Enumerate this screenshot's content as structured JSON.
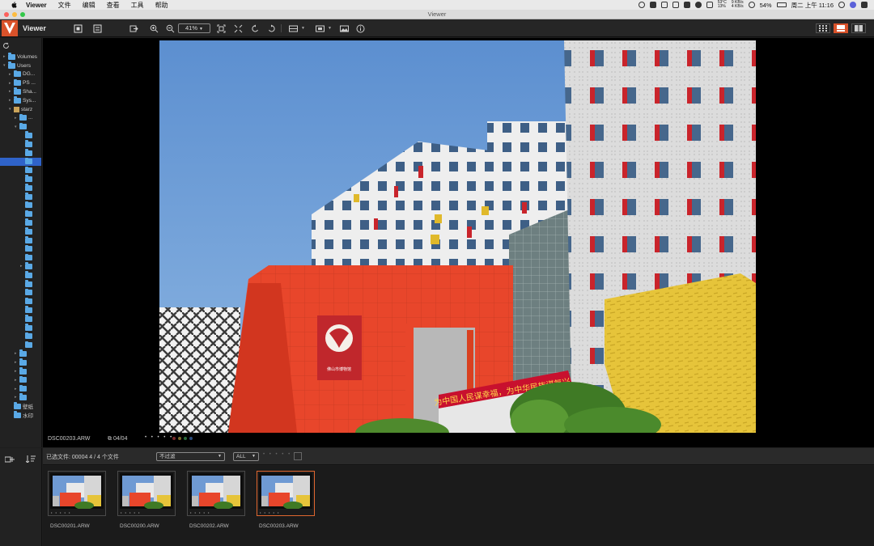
{
  "menubar": {
    "items": [
      "Viewer",
      "文件",
      "编辑",
      "查看",
      "工具",
      "帮助"
    ],
    "temp_top": "53°C",
    "temp_bottom": "13%",
    "net_top": "9 KB/s",
    "net_bottom": "4 KB/s",
    "battery": "54%",
    "clock": "周二 上午 11:16"
  },
  "window": {
    "title": "Viewer"
  },
  "toolbar": {
    "app_name": "Viewer",
    "zoom_level": "41%",
    "icons": [
      "fit-icon",
      "fullscreen-icon",
      "export-icon",
      "zoom-in-icon",
      "zoom-out-icon",
      "fit-screen-icon",
      "expand-icon",
      "rotate-left-icon",
      "rotate-right-icon",
      "compare-icon",
      "slideshow-icon",
      "image-icon",
      "info-icon",
      "grid-view-icon",
      "single-view-icon",
      "split-view-icon"
    ]
  },
  "sidebar": {
    "tree": [
      {
        "label": "Volumes",
        "indent": 0,
        "tri": "▸"
      },
      {
        "label": "Users",
        "indent": 0,
        "tri": "▾"
      },
      {
        "label": "DG...",
        "indent": 1,
        "tri": "▸"
      },
      {
        "label": "PS ...",
        "indent": 1,
        "tri": "▸"
      },
      {
        "label": "Sha...",
        "indent": 1,
        "tri": "▸"
      },
      {
        "label": "Sys...",
        "indent": 1,
        "tri": "▸"
      },
      {
        "label": "starz",
        "indent": 1,
        "tri": "▾",
        "home": true
      },
      {
        "label": "...",
        "indent": 2,
        "tri": "▸"
      },
      {
        "label": "",
        "indent": 2,
        "tri": "▾"
      },
      {
        "label": "",
        "indent": 3,
        "tri": ""
      },
      {
        "label": "",
        "indent": 3,
        "tri": ""
      },
      {
        "label": "",
        "indent": 3,
        "tri": ""
      },
      {
        "label": "",
        "indent": 3,
        "tri": "",
        "selected": true
      },
      {
        "label": "",
        "indent": 3,
        "tri": ""
      },
      {
        "label": "",
        "indent": 3,
        "tri": ""
      },
      {
        "label": "",
        "indent": 3,
        "tri": ""
      },
      {
        "label": "",
        "indent": 3,
        "tri": ""
      },
      {
        "label": "",
        "indent": 3,
        "tri": ""
      },
      {
        "label": "",
        "indent": 3,
        "tri": ""
      },
      {
        "label": "",
        "indent": 3,
        "tri": ""
      },
      {
        "label": "",
        "indent": 3,
        "tri": ""
      },
      {
        "label": "",
        "indent": 3,
        "tri": ""
      },
      {
        "label": "",
        "indent": 3,
        "tri": ""
      },
      {
        "label": "",
        "indent": 3,
        "tri": ""
      },
      {
        "label": "",
        "indent": 3,
        "tri": "▸"
      },
      {
        "label": "",
        "indent": 3,
        "tri": ""
      },
      {
        "label": "",
        "indent": 3,
        "tri": ""
      },
      {
        "label": "",
        "indent": 3,
        "tri": ""
      },
      {
        "label": "",
        "indent": 3,
        "tri": ""
      },
      {
        "label": "",
        "indent": 3,
        "tri": ""
      },
      {
        "label": "",
        "indent": 3,
        "tri": ""
      },
      {
        "label": "",
        "indent": 3,
        "tri": ""
      },
      {
        "label": "",
        "indent": 3,
        "tri": ""
      },
      {
        "label": "",
        "indent": 3,
        "tri": ""
      },
      {
        "label": "",
        "indent": 2,
        "tri": "▸"
      },
      {
        "label": "",
        "indent": 2,
        "tri": "▸"
      },
      {
        "label": "",
        "indent": 2,
        "tri": "▸"
      },
      {
        "label": "",
        "indent": 2,
        "tri": "▸"
      },
      {
        "label": "",
        "indent": 2,
        "tri": "▸"
      },
      {
        "label": "",
        "indent": 2,
        "tri": "▸"
      },
      {
        "label": "壁纸",
        "indent": 1,
        "tri": ""
      },
      {
        "label": "水印",
        "indent": 1,
        "tri": ""
      }
    ]
  },
  "viewer": {
    "filename": "DSC00203.ARW",
    "counter": "04/04",
    "rating_stars": "• • • • •",
    "photo_description_icon": "photo-buildings",
    "sign_logo_text": "佛山市博物馆",
    "banner_text": "为中国人民谋幸福，为中华民族谋复兴"
  },
  "bottom_bar": {
    "selection_info": "已选文件: 00004   4 / 4 个文件",
    "filter_label": "不过滤",
    "all_label": "ALL",
    "filter_stars": "• • • • •"
  },
  "filmstrip": [
    {
      "name": "DSC00201.ARW",
      "selected": false
    },
    {
      "name": "DSC00200.ARW",
      "selected": false
    },
    {
      "name": "DSC00202.ARW",
      "selected": false
    },
    {
      "name": "DSC00203.ARW",
      "selected": true
    }
  ],
  "colors": {
    "accent": "#e0672f",
    "selection": "#2f63c9",
    "folder": "#5aa9e6"
  }
}
